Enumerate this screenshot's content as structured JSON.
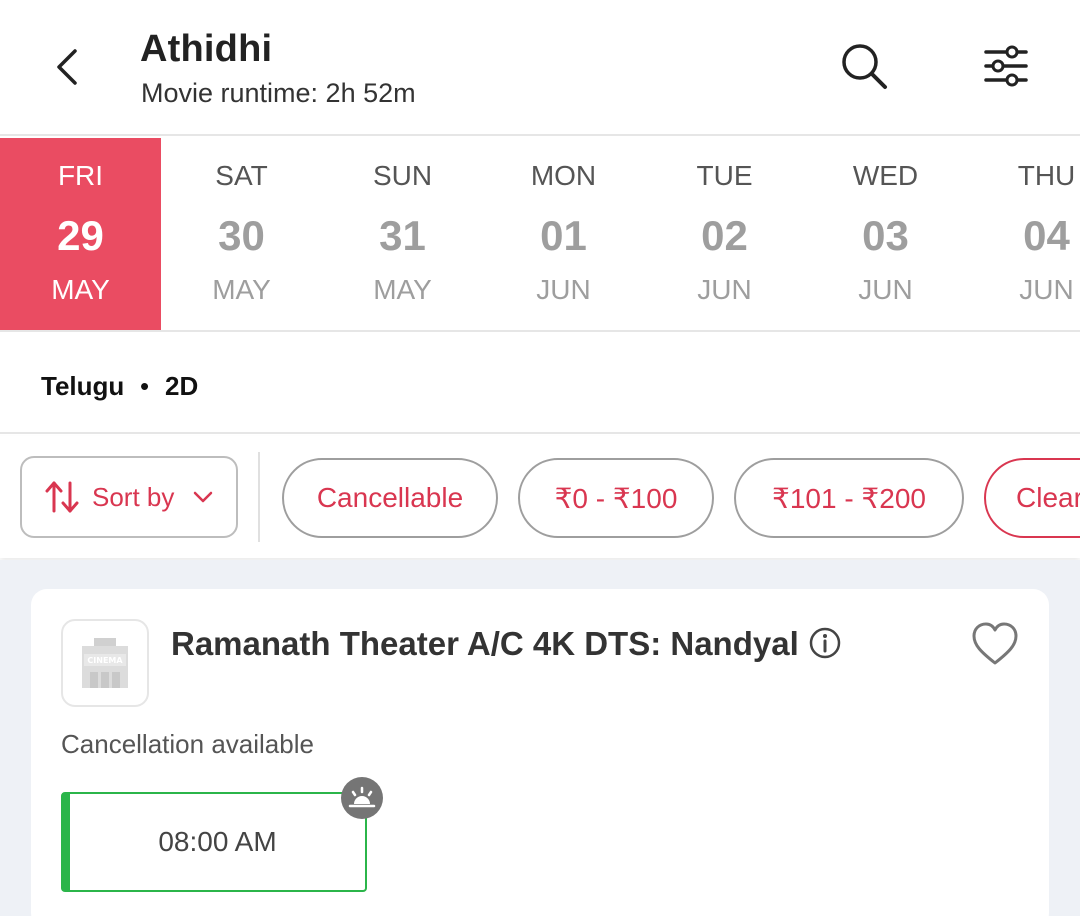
{
  "header": {
    "title": "Athidhi",
    "subtitle": "Movie runtime: 2h 52m"
  },
  "dates": [
    {
      "dow": "FRI",
      "day": "29",
      "mon": "MAY",
      "active": true
    },
    {
      "dow": "SAT",
      "day": "30",
      "mon": "MAY",
      "active": false
    },
    {
      "dow": "SUN",
      "day": "31",
      "mon": "MAY",
      "active": false
    },
    {
      "dow": "MON",
      "day": "01",
      "mon": "JUN",
      "active": false
    },
    {
      "dow": "TUE",
      "day": "02",
      "mon": "JUN",
      "active": false
    },
    {
      "dow": "WED",
      "day": "03",
      "mon": "JUN",
      "active": false
    },
    {
      "dow": "THU",
      "day": "04",
      "mon": "JUN",
      "active": false
    }
  ],
  "format": {
    "language": "Telugu",
    "separator": "•",
    "type": "2D"
  },
  "filters": {
    "sort_label": "Sort by",
    "chips": [
      "Cancellable",
      "₹0 - ₹100",
      "₹101 - ₹200",
      "Clear"
    ]
  },
  "theater": {
    "name": "Ramanath Theater A/C 4K DTS: Nandyal",
    "logo_text": "CINEMA",
    "cancellation": "Cancellation available",
    "showtimes": [
      {
        "time": "08:00 AM",
        "icon": "sunrise-icon"
      }
    ]
  },
  "colors": {
    "accent": "#ea4c62",
    "chip_text": "#d93650",
    "available_green": "#2bb54a",
    "background": "#eef1f6"
  }
}
